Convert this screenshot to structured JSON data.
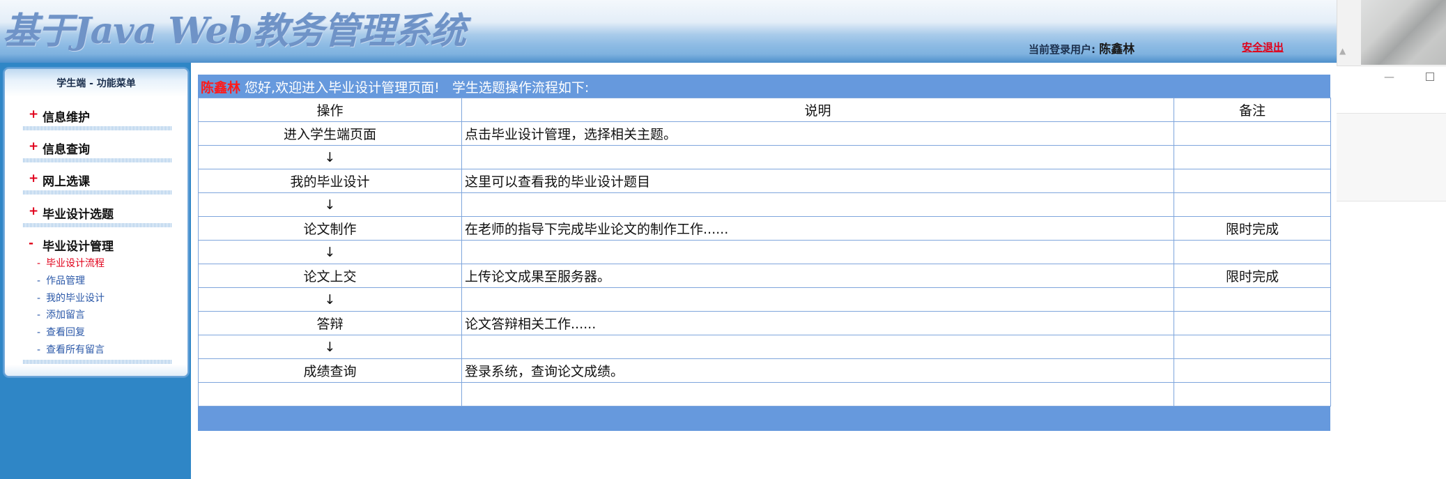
{
  "header": {
    "title": "基于Java Web教务管理系统",
    "login_label": "当前登录用户:",
    "login_user": "陈鑫林",
    "logout": "安全退出"
  },
  "sidebar": {
    "title": "学生端 - 功能菜单",
    "groups": [
      {
        "sign": "+",
        "label": "信息维护"
      },
      {
        "sign": "+",
        "label": "信息查询"
      },
      {
        "sign": "+",
        "label": "网上选课"
      },
      {
        "sign": "+",
        "label": "毕业设计选题"
      },
      {
        "sign": "-",
        "label": "毕业设计管理"
      }
    ],
    "subitems": [
      {
        "dash": "-",
        "label": "毕业设计流程"
      },
      {
        "dash": "-",
        "label": "作品管理"
      },
      {
        "dash": "-",
        "label": "我的毕业设计"
      },
      {
        "dash": "-",
        "label": "添加留言"
      },
      {
        "dash": "-",
        "label": "查看回复"
      },
      {
        "dash": "-",
        "label": "查看所有留言"
      }
    ]
  },
  "main": {
    "welcome_user": "陈鑫林",
    "welcome_text": " 您好,欢迎进入毕业设计管理页面!   学生选题操作流程如下:",
    "columns": [
      "操作",
      "说明",
      "备注"
    ],
    "rows": [
      {
        "op": "进入学生端页面",
        "desc": "点击毕业设计管理，选择相关主题。",
        "note": ""
      },
      {
        "op": "↓",
        "desc": "",
        "note": ""
      },
      {
        "op": "我的毕业设计",
        "desc": "这里可以查看我的毕业设计题目",
        "note": ""
      },
      {
        "op": "↓",
        "desc": "",
        "note": ""
      },
      {
        "op": "论文制作",
        "desc": "在老师的指导下完成毕业论文的制作工作......",
        "note": "限时完成"
      },
      {
        "op": "↓",
        "desc": "",
        "note": ""
      },
      {
        "op": "论文上交",
        "desc": "上传论文成果至服务器。",
        "note": "限时完成"
      },
      {
        "op": "↓",
        "desc": "",
        "note": ""
      },
      {
        "op": "答辩",
        "desc": "论文答辩相关工作......",
        "note": ""
      },
      {
        "op": "↓",
        "desc": "",
        "note": ""
      },
      {
        "op": "成绩查询",
        "desc": "登录系统，查询论文成绩。",
        "note": ""
      },
      {
        "op": "",
        "desc": "",
        "note": ""
      }
    ]
  },
  "colors": {
    "accent_blue": "#6699dd",
    "sidebar_blue": "#2f86c6",
    "alert_red": "#e0001a"
  }
}
